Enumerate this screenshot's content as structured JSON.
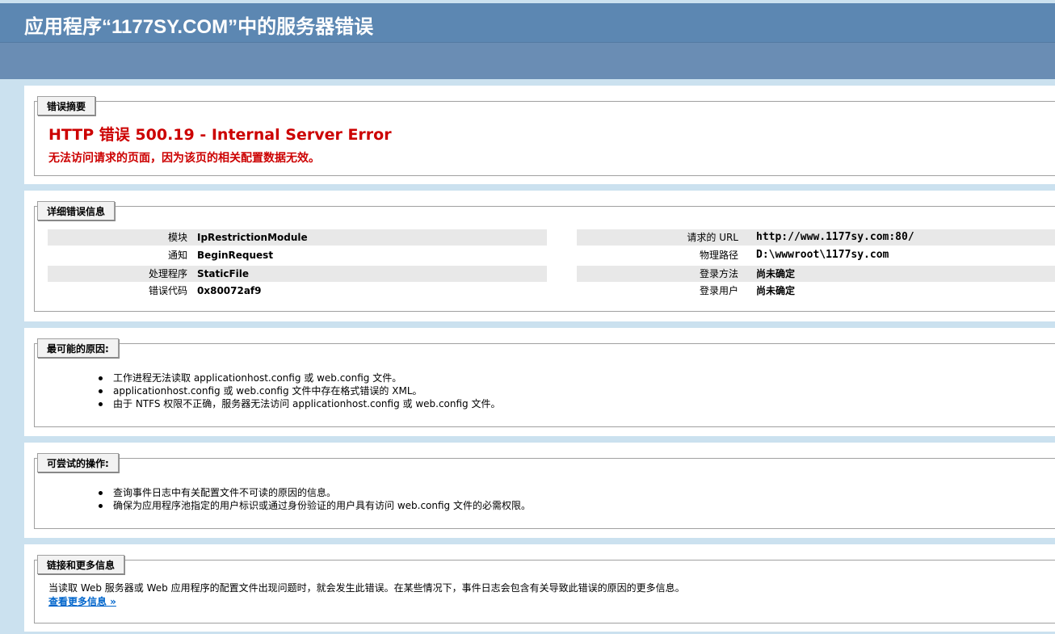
{
  "header": {
    "title": "应用程序“1177SY.COM”中的服务器错误"
  },
  "summary": {
    "legend": "错误摘要",
    "error_title": "HTTP 错误 500.19 - Internal Server Error",
    "error_sub": "无法访问请求的页面，因为该页的相关配置数据无效。"
  },
  "details": {
    "legend": "详细错误信息",
    "left": [
      {
        "label": "模块",
        "value": "IpRestrictionModule"
      },
      {
        "label": "通知",
        "value": "BeginRequest"
      },
      {
        "label": "处理程序",
        "value": "StaticFile"
      },
      {
        "label": "错误代码",
        "value": "0x80072af9"
      }
    ],
    "right": [
      {
        "label": "请求的 URL",
        "value": "http://www.1177sy.com:80/"
      },
      {
        "label": "物理路径",
        "value": "D:\\wwwroot\\1177sy.com"
      },
      {
        "label": "登录方法",
        "value": "尚未确定"
      },
      {
        "label": "登录用户",
        "value": "尚未确定"
      }
    ]
  },
  "causes": {
    "legend": "最可能的原因:",
    "items": [
      "工作进程无法读取 applicationhost.config 或 web.config 文件。",
      "applicationhost.config 或 web.config 文件中存在格式错误的 XML。",
      "由于 NTFS 权限不正确，服务器无法访问 applicationhost.config 或 web.config 文件。"
    ]
  },
  "actions": {
    "legend": "可尝试的操作:",
    "items": [
      "查询事件日志中有关配置文件不可读的原因的信息。",
      "确保为应用程序池指定的用户标识或通过身份验证的用户具有访问 web.config 文件的必需权限。"
    ]
  },
  "links": {
    "legend": "链接和更多信息",
    "text": "当读取 Web 服务器或 Web 应用程序的配置文件出现问题时，就会发生此错误。在某些情况下，事件日志会包含有关导致此错误的原因的更多信息。",
    "more_link": "查看更多信息 »"
  },
  "colors": {
    "header_bg": "#5c87b2",
    "page_bg": "#cbe1ef",
    "error_red": "#cc0000",
    "link_blue": "#0066cc"
  }
}
